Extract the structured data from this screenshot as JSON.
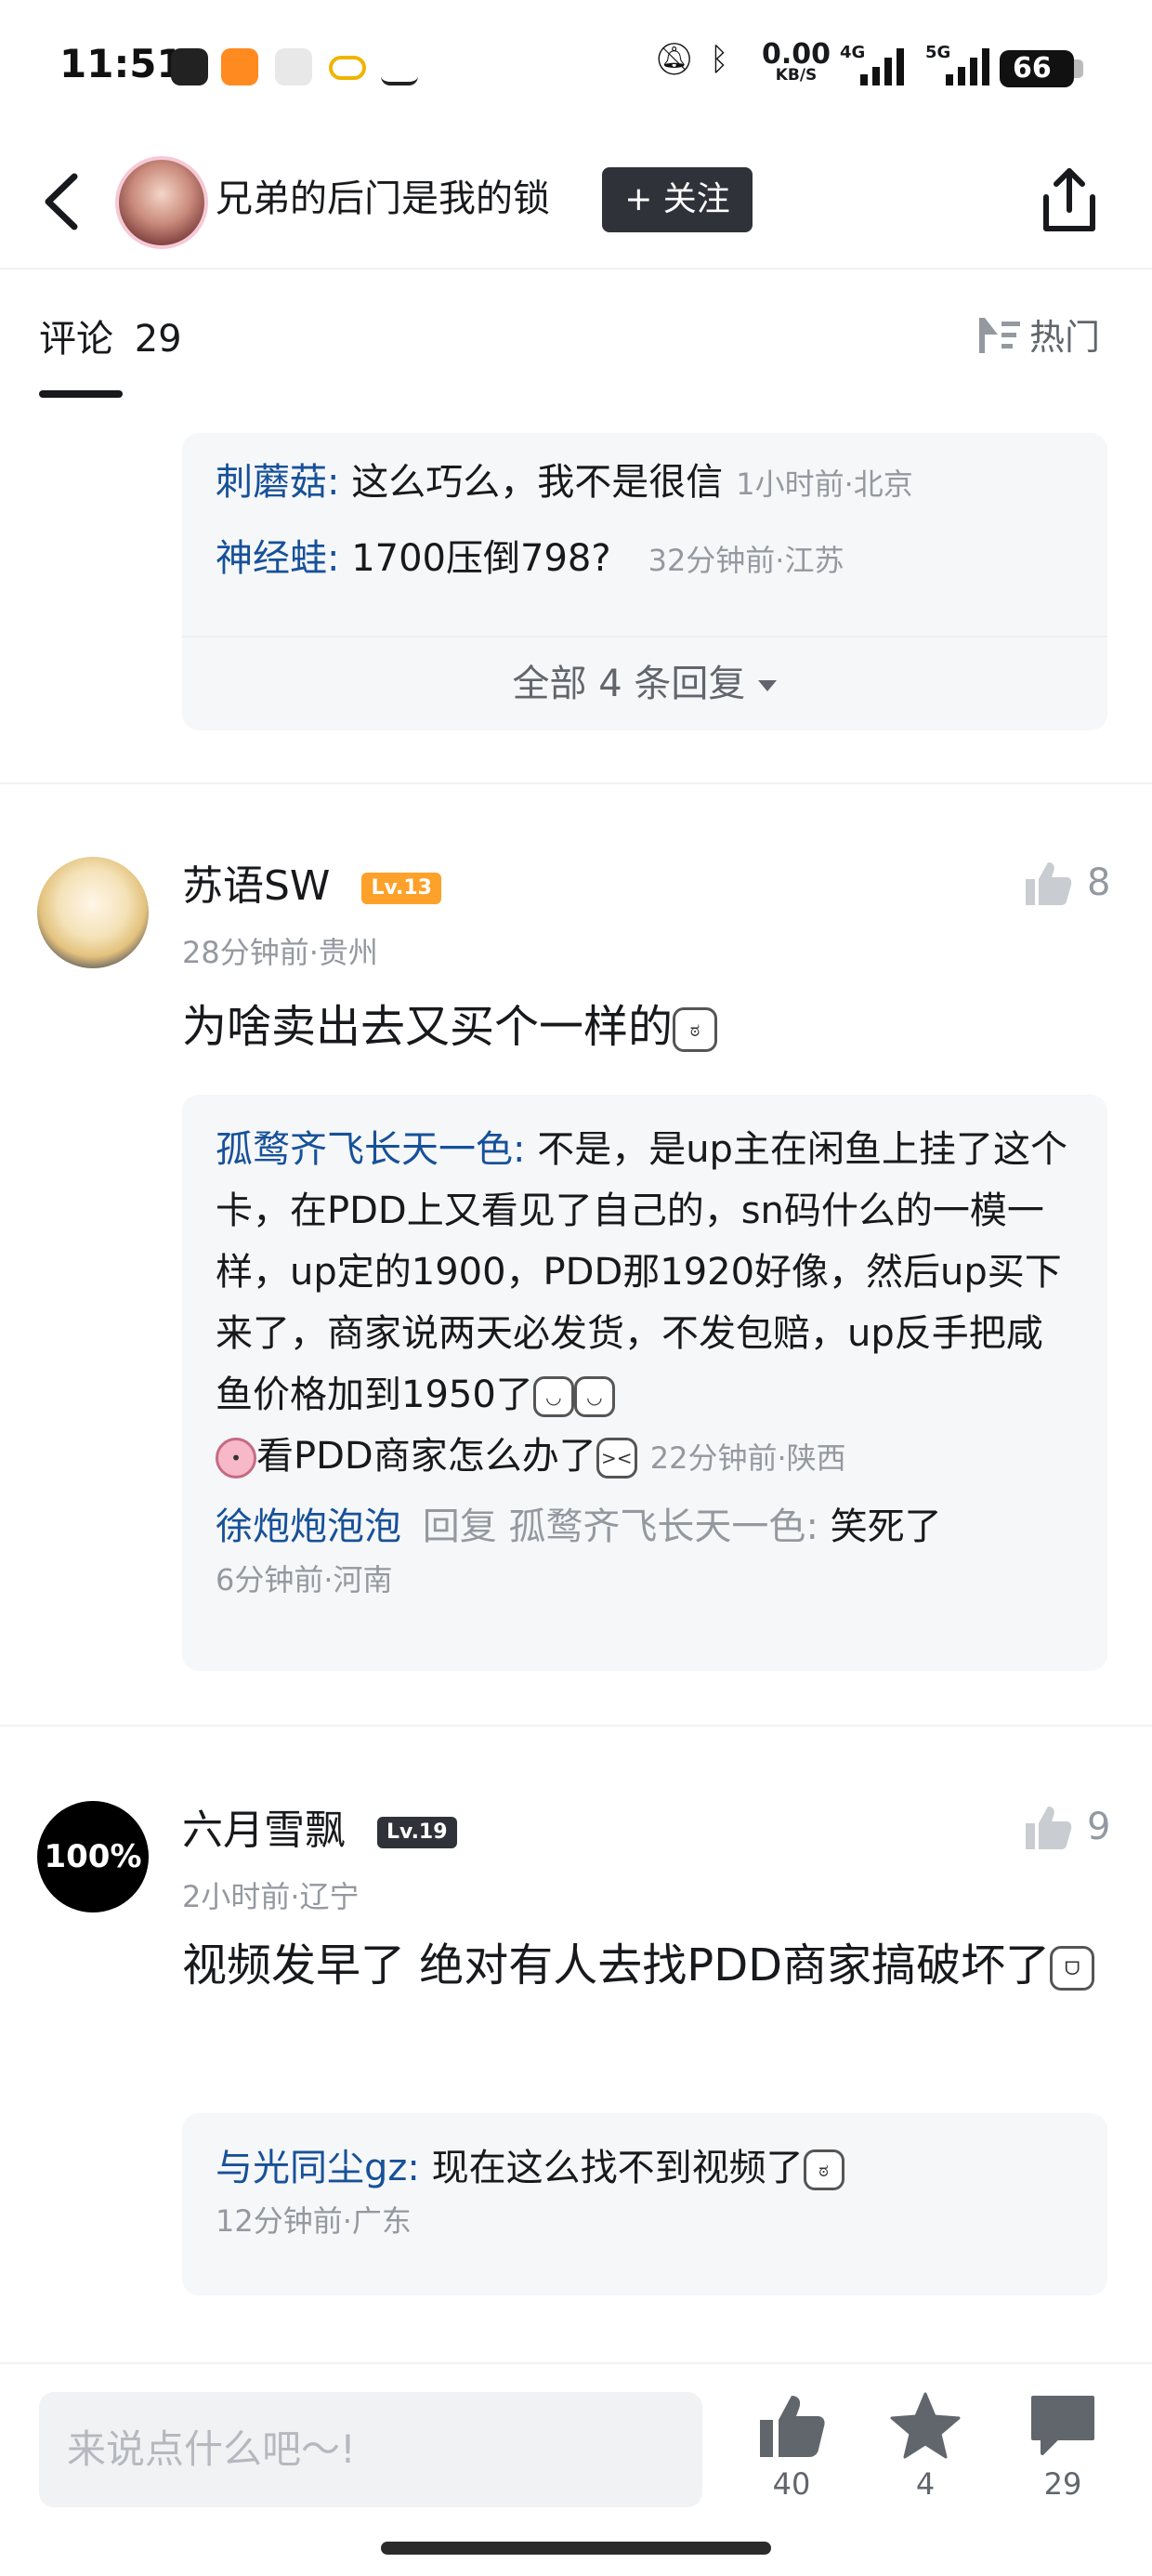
{
  "status_bar": {
    "time": "11:51",
    "net_speed": "0.00",
    "net_unit": "KB/S",
    "sig1_tag": "4G",
    "sig2_tag": "5G",
    "battery": "66"
  },
  "header": {
    "title": "兄弟的后门是我的锁",
    "follow_label": "+ 关注"
  },
  "tabs": {
    "comments_label": "评论",
    "comments_count": "29",
    "sort_label": "热门"
  },
  "prev_replies": {
    "items": [
      {
        "name": "刺蘑菇",
        "text": "这么巧么，我不是很信",
        "meta": "1小时前·北京"
      },
      {
        "name": "神经蛙",
        "text": "1700压倒798?",
        "meta": "32分钟前·江苏"
      }
    ],
    "expand_label": "全部 4 条回复"
  },
  "comments": [
    {
      "name": "苏语SW",
      "level": "Lv.13",
      "level_color": "#fda12a",
      "meta": "28分钟前·贵州",
      "text": "为啥卖出去又买个一样的",
      "likes": "8",
      "replies": [
        {
          "name": "孤鹜齐飞长天一色",
          "text": "不是，是up主在闲鱼上挂了这个卡，在PDD上又看见了自己的，sn码什么的一模一样，up定的1900，PDD那1920好像，然后up买下来了，商家说两天必发货，不发包赔，up反手把咸鱼价格加到1950了",
          "text2": "看PDD商家怎么办了",
          "meta": "22分钟前·陕西"
        },
        {
          "name": "徐炮炮泡泡",
          "reply_word": "回复",
          "reply_to": "孤鹜齐飞长天一色",
          "text": "笑死了",
          "meta": "6分钟前·河南"
        }
      ]
    },
    {
      "name": "六月雪飘",
      "level": "Lv.19",
      "level_color": "#2f3238",
      "avatar_text": "100%",
      "meta": "2小时前·辽宁",
      "text": "视频发早了 绝对有人去找PDD商家搞破坏了",
      "likes": "9",
      "replies": [
        {
          "name": "与光同尘gz",
          "text": "现在这么找不到视频了",
          "meta": "12分钟前·广东"
        }
      ]
    }
  ],
  "bottom_bar": {
    "input_placeholder": "来说点什么吧～!",
    "like_count": "40",
    "fav_count": "4",
    "comment_count": "29"
  }
}
